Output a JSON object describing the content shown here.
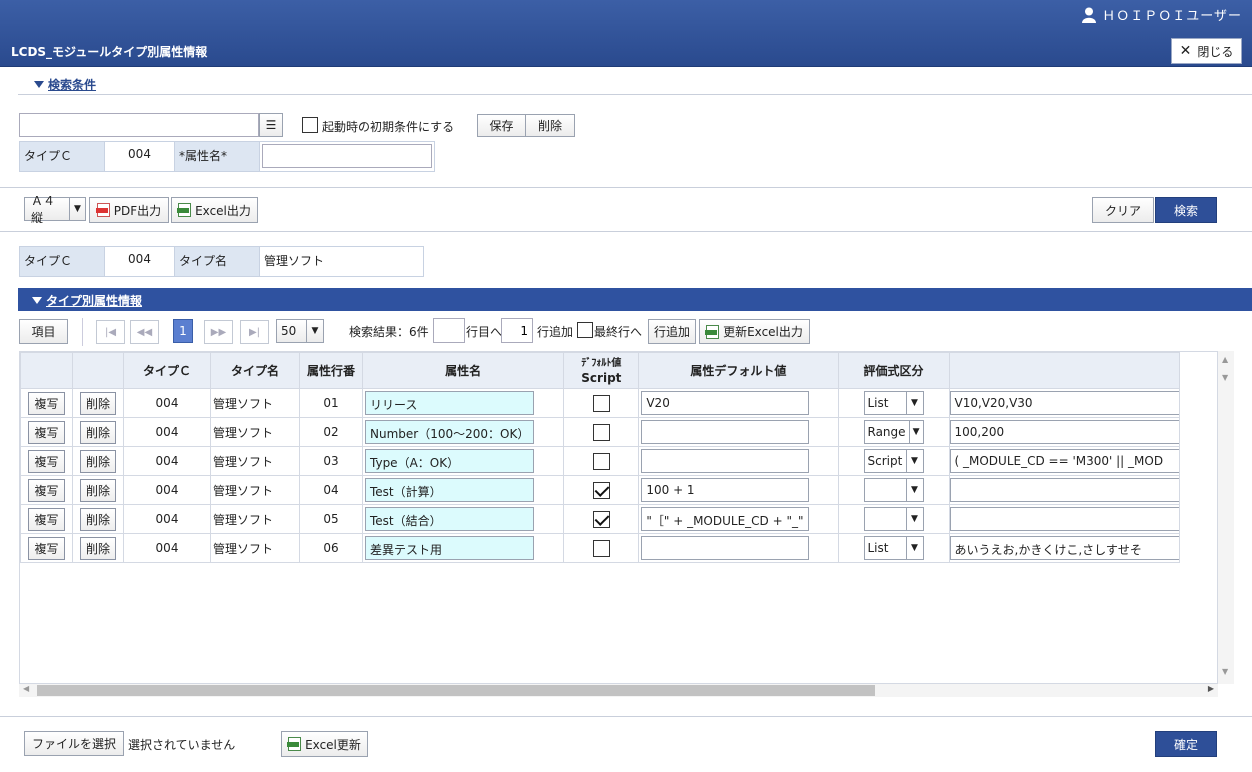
{
  "header": {
    "user_name": "ＨＯＩＰＯＩユーザー",
    "page_title": "LCDS_モジュールタイプ別属性情報",
    "close_label": "閉じる"
  },
  "search_section": {
    "title": "検索条件",
    "preset_value": "",
    "startup_label": "起動時の初期条件にする",
    "save_label": "保存",
    "delete_label": "削除",
    "type_c_label": "タイプＣ",
    "type_c_value": "004",
    "attr_name_label": "*属性名*",
    "attr_name_value": ""
  },
  "toolbar": {
    "paper_size": "Ａ４縦",
    "pdf_label": "PDF出力",
    "excel_label": "Excel出力",
    "clear_label": "クリア",
    "search_label": "検索"
  },
  "summary": {
    "type_c_label": "タイプＣ",
    "type_c_value": "004",
    "type_name_label": "タイプ名",
    "type_name_value": "管理ソフト"
  },
  "attr_section": {
    "title": "タイプ別属性情報",
    "items_label": "項目",
    "current_page": "1",
    "page_size": "50",
    "result_text": "検索結果：6件",
    "goto_value": "",
    "goto_suffix": "行目へ",
    "add_count": "1",
    "add_suffix": "行追加",
    "last_row_label": "最終行へ",
    "add_row_label": "行追加",
    "update_excel_label": "更新Excel出力"
  },
  "grid": {
    "headers": {
      "type_c": "タイプＣ",
      "type_name": "タイプ名",
      "row_no": "属性行番",
      "attr_name": "属性名",
      "default_script_top": "ﾃﾞﾌｫﾙﾄ値",
      "default_script_bottom": "Script",
      "default_value": "属性デフォルト値",
      "eval_type": "評価式区分",
      "eval_expr": ""
    },
    "copy_label": "複写",
    "delete_label": "削除",
    "rows": [
      {
        "type_c": "004",
        "type_name": "管理ソフト",
        "row_no": "01",
        "attr_name": "リリース",
        "script": false,
        "default_value": "V20",
        "eval_type": "List",
        "eval_expr": "V10,V20,V30"
      },
      {
        "type_c": "004",
        "type_name": "管理ソフト",
        "row_no": "02",
        "attr_name": "Number（100～200：OK）",
        "script": false,
        "default_value": "",
        "eval_type": "Range",
        "eval_expr": "100,200"
      },
      {
        "type_c": "004",
        "type_name": "管理ソフト",
        "row_no": "03",
        "attr_name": "Type（A：OK）",
        "script": false,
        "default_value": "",
        "eval_type": "Script",
        "eval_expr": "( _MODULE_CD == 'M300' || _MOD"
      },
      {
        "type_c": "004",
        "type_name": "管理ソフト",
        "row_no": "04",
        "attr_name": "Test（計算）",
        "script": true,
        "default_value": "100 + 1",
        "eval_type": "",
        "eval_expr": ""
      },
      {
        "type_c": "004",
        "type_name": "管理ソフト",
        "row_no": "05",
        "attr_name": "Test（結合）",
        "script": true,
        "default_value": "\"［\" + _MODULE_CD + \"_\"",
        "eval_type": "",
        "eval_expr": ""
      },
      {
        "type_c": "004",
        "type_name": "管理ソフト",
        "row_no": "06",
        "attr_name": "差異テスト用",
        "script": false,
        "default_value": "",
        "eval_type": "List",
        "eval_expr": "あいうえお,かきくけこ,さしすせそ"
      }
    ]
  },
  "footer": {
    "file_button": "ファイルを選択",
    "file_status": "選択されていません",
    "excel_update_label": "Excel更新",
    "confirm_label": "確定"
  },
  "colors": {
    "header_blue": "#2a4a8e",
    "primary_button": "#2e4f98",
    "label_cell": "#dde6f2",
    "editable_cell": "#dcfbfd"
  }
}
